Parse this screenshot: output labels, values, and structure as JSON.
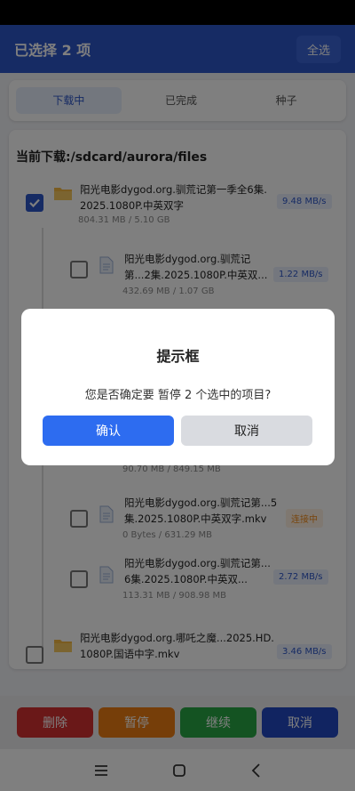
{
  "header": {
    "title": "已选择 2 项",
    "select_all": "全选"
  },
  "tabs": [
    "下载中",
    "已完成",
    "种子"
  ],
  "path": "当前下载:/sdcard/aurora/files",
  "items": [
    {
      "name1": "阳光电影dygod.org.驯荒记第一季全6集.",
      "name2": "2025.1080P.中英双字",
      "size": "804.31 MB / 5.10 GB",
      "speed": "9.48 MB/s"
    },
    {
      "name1": "阳光电影dygod.org.驯荒记",
      "name2": "第...2集.2025.1080P.中英双...",
      "size": "432.69 MB / 1.07 GB",
      "speed": "1.22 MB/s"
    },
    {
      "size": "90.70 MB / 849.15 MB"
    },
    {
      "name1": "阳光电影dygod.org.驯荒记第...5",
      "name2": "集.2025.1080P.中英双字.mkv",
      "size": "0 Bytes / 631.29 MB",
      "speed": "连接中"
    },
    {
      "name1": "阳光电影dygod.org.驯荒记第...",
      "name2": "6集.2025.1080P.中英双...",
      "size": "113.31 MB / 908.98 MB",
      "speed": "2.72 MB/s"
    },
    {
      "name1": "阳光电影dygod.org.哪吒之魔...2025.HD.",
      "name2": "1080P.国语中字.mkv",
      "speed": "3.46 MB/s"
    }
  ],
  "actions": {
    "delete": "删除",
    "pause": "暂停",
    "resume": "继续",
    "cancel": "取消"
  },
  "dialog": {
    "title": "提示框",
    "message": "您是否确定要 暂停 2 个选中的项目?",
    "confirm": "确认",
    "cancel": "取消"
  },
  "colors": {
    "primary": "#2d56c8",
    "delete": "#d43131",
    "pause": "#ed7d12",
    "resume": "#28a745",
    "cancel": "#2349c2"
  }
}
